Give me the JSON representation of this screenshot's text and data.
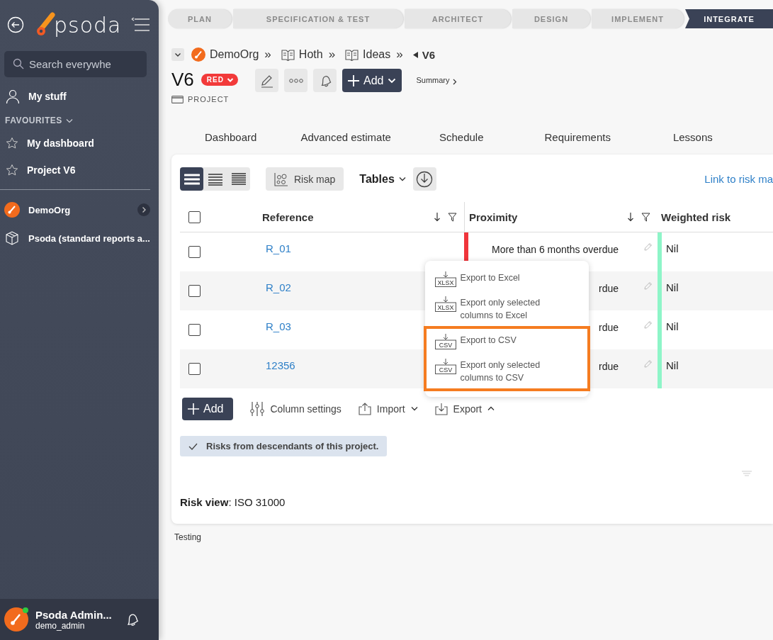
{
  "sidebar": {
    "logo": "psoda",
    "search": {
      "placeholder": "Search everywhe"
    },
    "my_stuff": "My stuff",
    "favourites": {
      "label": "FAVOURITES",
      "expanded": true,
      "items": [
        {
          "label": "My dashboard"
        },
        {
          "label": "Project V6"
        }
      ]
    },
    "orgs": [
      {
        "label": "DemoOrg",
        "kind": "org"
      },
      {
        "label": "Psoda (standard reports a...",
        "kind": "package"
      }
    ],
    "user": {
      "name": "Psoda Admin...",
      "login": "demo_admin",
      "online": true
    }
  },
  "stages": [
    {
      "label": "PLAN",
      "selected": false
    },
    {
      "label": "SPECIFICATION & TEST",
      "selected": false
    },
    {
      "label": "ARCHITECT",
      "selected": false
    },
    {
      "label": "DESIGN",
      "selected": false
    },
    {
      "label": "IMPLEMENT",
      "selected": false
    },
    {
      "label": "INTEGRATE",
      "selected": true
    }
  ],
  "breadcrumb": [
    {
      "label": "DemoOrg",
      "kind": "org",
      "separator": "»"
    },
    {
      "label": "Hoth",
      "kind": "book",
      "separator": "»"
    },
    {
      "label": "Ideas",
      "kind": "book",
      "separator": "»"
    },
    {
      "label": "V6",
      "kind": "current"
    }
  ],
  "title": {
    "name": "V6",
    "status": "RED",
    "type": "PROJECT",
    "add_button": "Add",
    "summary_link": "Summary"
  },
  "tabs": [
    {
      "label": "Dashboard",
      "selected": false
    },
    {
      "label": "Advanced estimate",
      "selected": false
    },
    {
      "label": "Schedule",
      "selected": false
    },
    {
      "label": "Requirements",
      "selected": false
    },
    {
      "label": "Lessons",
      "selected": false
    }
  ],
  "toolbar": {
    "views": [
      {
        "kind": "compact",
        "selected": true
      },
      {
        "kind": "medium",
        "selected": false
      },
      {
        "kind": "dense",
        "selected": false
      }
    ],
    "risk_map": "Risk map",
    "tables": "Tables",
    "link": "Link to risk ma"
  },
  "table": {
    "select_all": false,
    "columns": [
      "Reference",
      "Proximity",
      "Weighted risk"
    ],
    "rows": [
      {
        "checked": false,
        "reference": "R_01",
        "proximity": {
          "text": "More than 6 months overdue",
          "color": "#f0353b"
        },
        "weighted_risk": {
          "text": "Nil",
          "color": "#8ef5c8"
        }
      },
      {
        "checked": false,
        "reference": "R_02",
        "proximity": {
          "text": "rdue"
        },
        "weighted_risk": {
          "text": "Nil",
          "color": "#8ef5c8"
        }
      },
      {
        "checked": false,
        "reference": "R_03",
        "proximity": {
          "text": "rdue"
        },
        "weighted_risk": {
          "text": "Nil",
          "color": "#8ef5c8"
        }
      },
      {
        "checked": false,
        "reference": "12356",
        "proximity": {
          "text": "rdue"
        },
        "weighted_risk": {
          "text": "Nil",
          "color": "#8ef5c8"
        }
      }
    ]
  },
  "export_menu": [
    {
      "label": "Export to Excel",
      "icon_label": "XLSX",
      "highlighted": false
    },
    {
      "label": "Export only selected columns to Excel",
      "icon_label": "XLSX",
      "highlighted": false
    },
    {
      "label": "Export to CSV",
      "icon_label": "CSV",
      "highlighted": true
    },
    {
      "label": "Export only selected columns to CSV",
      "icon_label": "CSV",
      "highlighted": true
    }
  ],
  "actions": {
    "add": "Add",
    "column_settings": "Column settings",
    "import": {
      "label": "Import",
      "expanded": false
    },
    "export": {
      "label": "Export",
      "expanded": true
    }
  },
  "filter_chip": {
    "label": "Risks from descendants of this project.",
    "checked": true
  },
  "risk_view": "**Risk view**: ISO 31000",
  "footer_note": "Testing"
}
